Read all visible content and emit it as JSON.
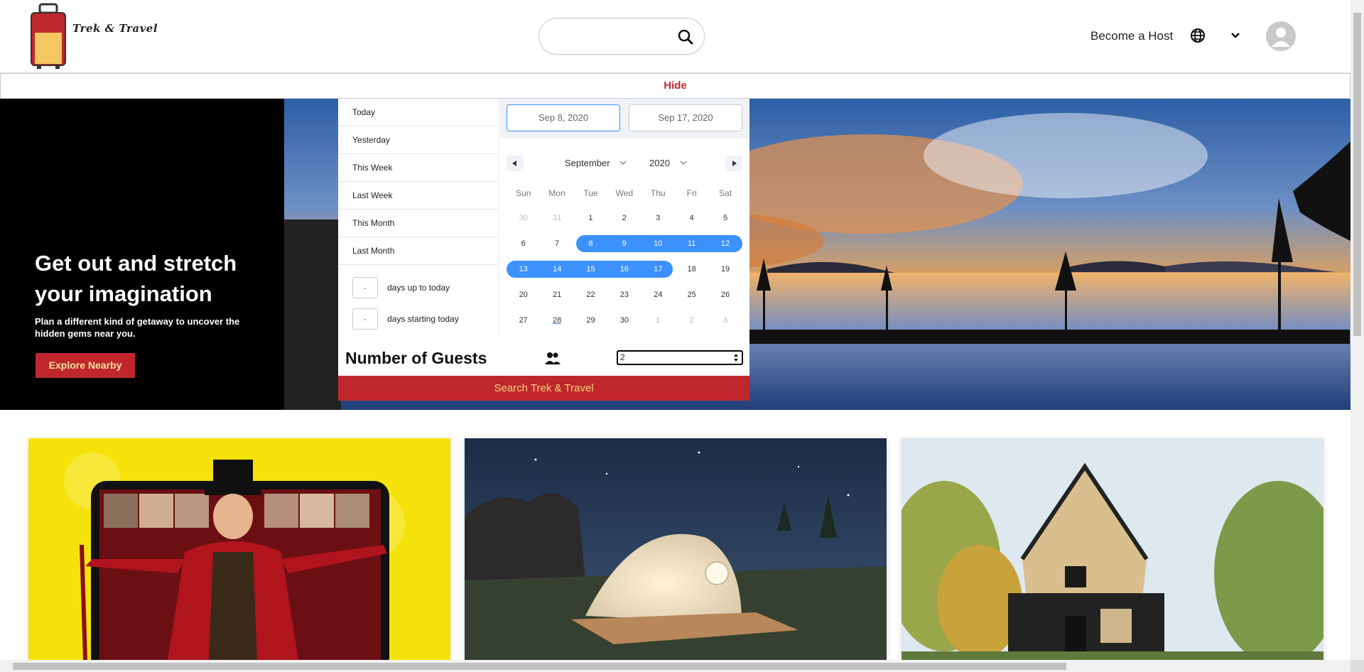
{
  "header": {
    "brand": "Trek & Travel",
    "search_placeholder": "",
    "become_host": "Become a Host",
    "icons": [
      "suitcase-logo",
      "search-icon",
      "globe-icon",
      "chevron-down-icon",
      "user-avatar-icon"
    ]
  },
  "hide_label": "Hide",
  "hero": {
    "title": "Get out and stretch your imagination",
    "subtitle": "Plan a different kind of getaway to uncover the hidden gems near you.",
    "cta": "Explore Nearby"
  },
  "picker": {
    "ranges": [
      "Today",
      "Yesterday",
      "This Week",
      "Last Week",
      "This Month",
      "Last Month"
    ],
    "days_up_label": "days up to today",
    "days_start_label": "days starting today",
    "days_up_value": "-",
    "days_start_value": "-",
    "start_date": "Sep 8, 2020",
    "end_date": "Sep 17, 2020",
    "month": "September",
    "year": "2020",
    "weekdays": [
      "Sun",
      "Mon",
      "Tue",
      "Wed",
      "Thu",
      "Fri",
      "Sat"
    ],
    "weeks": [
      [
        "30",
        "31",
        "1",
        "2",
        "3",
        "4",
        "5"
      ],
      [
        "6",
        "7",
        "8",
        "9",
        "10",
        "11",
        "12"
      ],
      [
        "13",
        "14",
        "15",
        "16",
        "17",
        "18",
        "19"
      ],
      [
        "20",
        "21",
        "22",
        "23",
        "24",
        "25",
        "26"
      ],
      [
        "27",
        "28",
        "29",
        "30",
        "1",
        "2",
        "3"
      ]
    ],
    "selected_range": [
      "8",
      "17"
    ],
    "today": "28"
  },
  "guests": {
    "label": "Number of Guests",
    "value": "2"
  },
  "search_button": "Search Trek & Travel",
  "colors": {
    "brand_red": "#c0272d",
    "accent_blue": "#3d91ff",
    "cta_text": "#f6e39a"
  }
}
